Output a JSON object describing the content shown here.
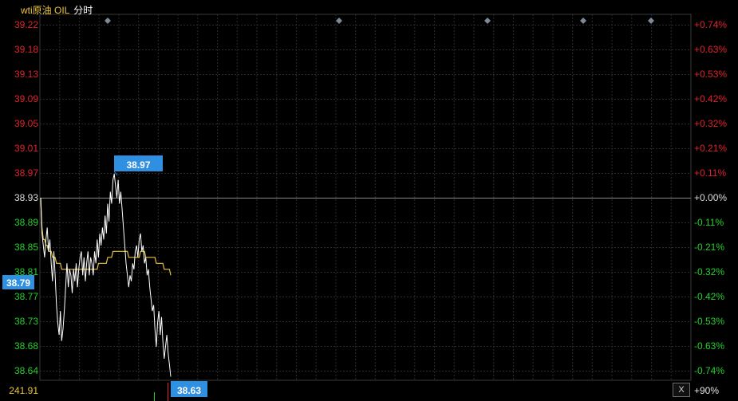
{
  "header": {
    "instrument": "wti原油 OIL",
    "mode": "分时"
  },
  "footer": {
    "volume_label": "241.91",
    "pct_label": "+90%",
    "close_button": "X"
  },
  "colors": {
    "up": "#e0212b",
    "down": "#22d12a",
    "flat": "#dcdcdc",
    "price_line": "#ffffff",
    "avg_line": "#e8c43a",
    "grid": "#2a2a2a",
    "marker_bg": "#2f8fe0"
  },
  "chart_data": {
    "type": "line",
    "title": "",
    "xlabel": "",
    "ylabel": "",
    "ylim": [
      38.62,
      39.235
    ],
    "prev_close": 38.93,
    "y_ticks": [
      "39.22",
      "39.18",
      "39.13",
      "39.09",
      "39.05",
      "39.01",
      "38.97",
      "38.93",
      "38.89",
      "38.85",
      "38.81",
      "38.77",
      "38.73",
      "38.68",
      "38.64"
    ],
    "pct_ticks": [
      "+0.74%",
      "+0.63%",
      "+0.53%",
      "+0.42%",
      "+0.32%",
      "+0.21%",
      "+0.11%",
      "+0.00%",
      "-0.11%",
      "-0.21%",
      "-0.32%",
      "-0.42%",
      "-0.53%",
      "-0.63%",
      "-0.74%"
    ],
    "current_price_label": "38.79",
    "high_label": "38.97",
    "last_label": "38.63",
    "series": [
      {
        "values": [
          38.93,
          38.87,
          38.85,
          38.83,
          38.86,
          38.88,
          38.84,
          38.86,
          38.82,
          38.79,
          38.84,
          38.8,
          38.75,
          38.72,
          38.7,
          38.74,
          38.69,
          38.71,
          38.74,
          38.78,
          38.82,
          38.78,
          38.81,
          38.8,
          38.77,
          38.81,
          38.79,
          38.82,
          38.78,
          38.81,
          38.83,
          38.84,
          38.8,
          38.83,
          38.79,
          38.82,
          38.84,
          38.8,
          38.83,
          38.82,
          38.8,
          38.84,
          38.82,
          38.86,
          38.83,
          38.87,
          38.85,
          38.88,
          38.86,
          38.9,
          38.87,
          38.92,
          38.89,
          38.94,
          38.92,
          38.96,
          38.97,
          38.95,
          38.93,
          38.96,
          38.92,
          38.94,
          38.91,
          38.88,
          38.85,
          38.82,
          38.8,
          38.78,
          38.8,
          38.79,
          38.82,
          38.81,
          38.84,
          38.85,
          38.83,
          38.86,
          38.87,
          38.84,
          38.85,
          38.82,
          38.83,
          38.8,
          38.81,
          38.78,
          38.76,
          38.74,
          38.75,
          38.71,
          38.68,
          38.72,
          38.74,
          38.7,
          38.73,
          38.69,
          38.66,
          38.68,
          38.7,
          38.67,
          38.65,
          38.63
        ]
      },
      {
        "values": [
          38.93,
          38.88,
          38.86,
          38.86,
          38.85,
          38.85,
          38.84,
          38.84,
          38.84,
          38.83,
          38.83,
          38.83,
          38.82,
          38.82,
          38.82,
          38.82,
          38.81,
          38.81,
          38.81,
          38.81,
          38.81,
          38.81,
          38.81,
          38.81,
          38.81,
          38.81,
          38.81,
          38.81,
          38.81,
          38.81,
          38.81,
          38.81,
          38.81,
          38.81,
          38.81,
          38.81,
          38.81,
          38.81,
          38.81,
          38.81,
          38.81,
          38.81,
          38.81,
          38.81,
          38.82,
          38.82,
          38.82,
          38.82,
          38.82,
          38.82,
          38.82,
          38.83,
          38.83,
          38.83,
          38.83,
          38.84,
          38.84,
          38.84,
          38.84,
          38.84,
          38.84,
          38.84,
          38.84,
          38.84,
          38.84,
          38.84,
          38.84,
          38.83,
          38.83,
          38.83,
          38.83,
          38.83,
          38.83,
          38.83,
          38.83,
          38.83,
          38.84,
          38.84,
          38.84,
          38.84,
          38.83,
          38.83,
          38.83,
          38.83,
          38.83,
          38.83,
          38.83,
          38.83,
          38.82,
          38.82,
          38.82,
          38.82,
          38.82,
          38.82,
          38.81,
          38.81,
          38.81,
          38.81,
          38.81,
          38.8
        ]
      }
    ],
    "event_markers": 5
  }
}
